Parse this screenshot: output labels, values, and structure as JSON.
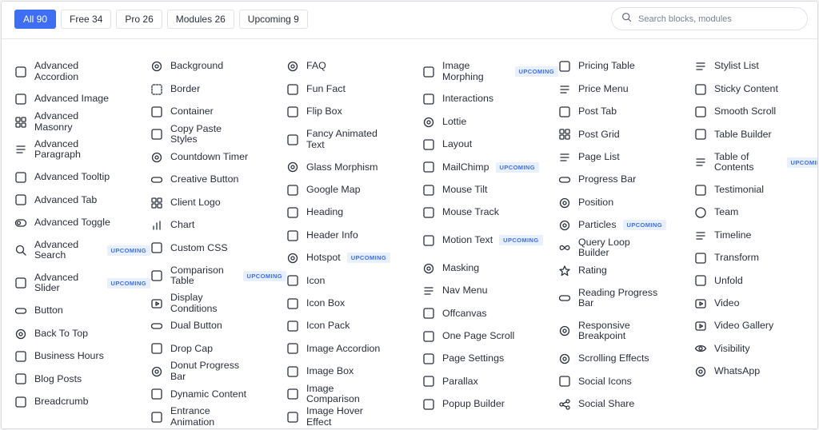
{
  "tabs": [
    {
      "label": "All 90",
      "active": true
    },
    {
      "label": "Free 34",
      "active": false
    },
    {
      "label": "Pro 26",
      "active": false
    },
    {
      "label": "Modules 26",
      "active": false
    },
    {
      "label": "Upcoming 9",
      "active": false
    }
  ],
  "search": {
    "placeholder": "Search blocks, modules"
  },
  "badge_text": "UPCOMING",
  "colors": {
    "accent": "#3d6ef3",
    "badge_bg": "#e8effd"
  },
  "columns": [
    [
      {
        "label": "Advanced Accordion",
        "icon": "accordion-icon"
      },
      {
        "label": "Advanced Image",
        "icon": "image-icon"
      },
      {
        "label": "Advanced Masonry",
        "icon": "masonry-icon"
      },
      {
        "label": "Advanced Paragraph",
        "icon": "paragraph-icon"
      },
      {
        "label": "Advanced Tooltip",
        "icon": "tooltip-icon"
      },
      {
        "label": "Advanced Tab",
        "icon": "tab-icon"
      },
      {
        "label": "Advanced Toggle",
        "icon": "toggle-icon"
      },
      {
        "label": "Advanced Search",
        "icon": "search-box-icon",
        "upcoming": true
      },
      {
        "label": "Advanced Slider",
        "icon": "slider-icon",
        "upcoming": true
      },
      {
        "label": "Button",
        "icon": "button-icon"
      },
      {
        "label": "Back To Top",
        "icon": "back-to-top-icon"
      },
      {
        "label": "Business Hours",
        "icon": "briefcase-icon"
      },
      {
        "label": "Blog Posts",
        "icon": "blog-posts-icon"
      },
      {
        "label": "Breadcrumb",
        "icon": "breadcrumb-icon"
      }
    ],
    [
      {
        "label": "Background",
        "icon": "background-icon"
      },
      {
        "label": "Border",
        "icon": "border-icon"
      },
      {
        "label": "Container",
        "icon": "container-icon"
      },
      {
        "label": "Copy Paste Styles",
        "icon": "copy-icon"
      },
      {
        "label": "Countdown Timer",
        "icon": "timer-icon"
      },
      {
        "label": "Creative Button",
        "icon": "creative-button-icon"
      },
      {
        "label": "Client Logo",
        "icon": "client-logo-icon"
      },
      {
        "label": "Chart",
        "icon": "chart-icon"
      },
      {
        "label": "Custom CSS",
        "icon": "css-icon"
      },
      {
        "label": "Comparison Table",
        "icon": "comparison-table-icon",
        "upcoming": true
      },
      {
        "label": "Display Conditions",
        "icon": "display-conditions-icon"
      },
      {
        "label": "Dual Button",
        "icon": "dual-button-icon"
      },
      {
        "label": "Drop Cap",
        "icon": "drop-cap-icon"
      },
      {
        "label": "Donut Progress Bar",
        "icon": "percent-icon"
      },
      {
        "label": "Dynamic Content",
        "icon": "database-icon"
      },
      {
        "label": "Entrance Animation",
        "icon": "entrance-icon"
      }
    ],
    [
      {
        "label": "FAQ",
        "icon": "faq-icon"
      },
      {
        "label": "Fun Fact",
        "icon": "fun-fact-icon"
      },
      {
        "label": "Flip Box",
        "icon": "flip-box-icon"
      },
      {
        "label": "Fancy Animated Text",
        "icon": "pen-icon"
      },
      {
        "label": "Glass Morphism",
        "icon": "glass-icon"
      },
      {
        "label": "Google Map",
        "icon": "map-icon"
      },
      {
        "label": "Heading",
        "icon": "heading-icon"
      },
      {
        "label": "Header Info",
        "icon": "header-info-icon"
      },
      {
        "label": "Hotspot",
        "icon": "hotspot-icon",
        "upcoming": true
      },
      {
        "label": "Icon",
        "icon": "icon-icon"
      },
      {
        "label": "Icon Box",
        "icon": "icon-box-icon"
      },
      {
        "label": "Icon Pack",
        "icon": "svg-icon"
      },
      {
        "label": "Image Accordion",
        "icon": "image-accordion-icon"
      },
      {
        "label": "Image Box",
        "icon": "image-box-icon"
      },
      {
        "label": "Image Comparison",
        "icon": "image-comparison-icon"
      },
      {
        "label": "Image Hover Effect",
        "icon": "image-hover-icon"
      }
    ],
    [
      {
        "label": "Image Morphing",
        "icon": "morphing-icon",
        "upcoming": true
      },
      {
        "label": "Interactions",
        "icon": "pointer-hand-icon"
      },
      {
        "label": "Lottie",
        "icon": "lottie-icon"
      },
      {
        "label": "Layout",
        "icon": "layout-icon"
      },
      {
        "label": "MailChimp",
        "icon": "mailchimp-icon",
        "upcoming": true
      },
      {
        "label": "Mouse Tilt",
        "icon": "mouse-tilt-icon"
      },
      {
        "label": "Mouse Track",
        "icon": "cursor-icon"
      },
      {
        "label": "Motion Text",
        "icon": "motion-text-icon",
        "upcoming": true
      },
      {
        "label": "Masking",
        "icon": "masking-icon"
      },
      {
        "label": "Nav Menu",
        "icon": "nav-menu-icon"
      },
      {
        "label": "Offcanvas",
        "icon": "offcanvas-icon"
      },
      {
        "label": "One Page Scroll",
        "icon": "one-page-scroll-icon"
      },
      {
        "label": "Page Settings",
        "icon": "page-settings-icon"
      },
      {
        "label": "Parallax",
        "icon": "parallax-icon"
      },
      {
        "label": "Popup Builder",
        "icon": "popup-icon"
      }
    ],
    [
      {
        "label": "Pricing Table",
        "icon": "pricing-table-icon"
      },
      {
        "label": "Price Menu",
        "icon": "price-menu-icon"
      },
      {
        "label": "Post Tab",
        "icon": "post-tab-icon"
      },
      {
        "label": "Post Grid",
        "icon": "post-grid-icon"
      },
      {
        "label": "Page List",
        "icon": "page-list-icon"
      },
      {
        "label": "Progress Bar",
        "icon": "progress-bar-icon"
      },
      {
        "label": "Position",
        "icon": "position-icon"
      },
      {
        "label": "Particles",
        "icon": "particles-icon",
        "upcoming": true
      },
      {
        "label": "Query Loop Builder",
        "icon": "infinity-icon"
      },
      {
        "label": "Rating",
        "icon": "star-icon"
      },
      {
        "label": "Reading Progress Bar",
        "icon": "reading-progress-icon"
      },
      {
        "label": "Responsive Breakpoint",
        "icon": "responsive-icon"
      },
      {
        "label": "Scrolling Effects",
        "icon": "scrolling-effects-icon"
      },
      {
        "label": "Social Icons",
        "icon": "social-icons-icon"
      },
      {
        "label": "Social Share",
        "icon": "share-icon"
      }
    ],
    [
      {
        "label": "Stylist List",
        "icon": "list-icon"
      },
      {
        "label": "Sticky Content",
        "icon": "sticky-icon"
      },
      {
        "label": "Smooth Scroll",
        "icon": "smooth-scroll-icon"
      },
      {
        "label": "Table Builder",
        "icon": "table-icon"
      },
      {
        "label": "Table of Contents",
        "icon": "toc-icon",
        "upcoming": true
      },
      {
        "label": "Testimonial",
        "icon": "testimonial-icon"
      },
      {
        "label": "Team",
        "icon": "team-icon"
      },
      {
        "label": "Timeline",
        "icon": "timeline-icon"
      },
      {
        "label": "Transform",
        "icon": "transform-icon"
      },
      {
        "label": "Unfold",
        "icon": "unfold-icon"
      },
      {
        "label": "Video",
        "icon": "video-icon"
      },
      {
        "label": "Video Gallery",
        "icon": "video-gallery-icon"
      },
      {
        "label": "Visibility",
        "icon": "eye-icon"
      },
      {
        "label": "WhatsApp",
        "icon": "whatsapp-icon"
      }
    ]
  ]
}
